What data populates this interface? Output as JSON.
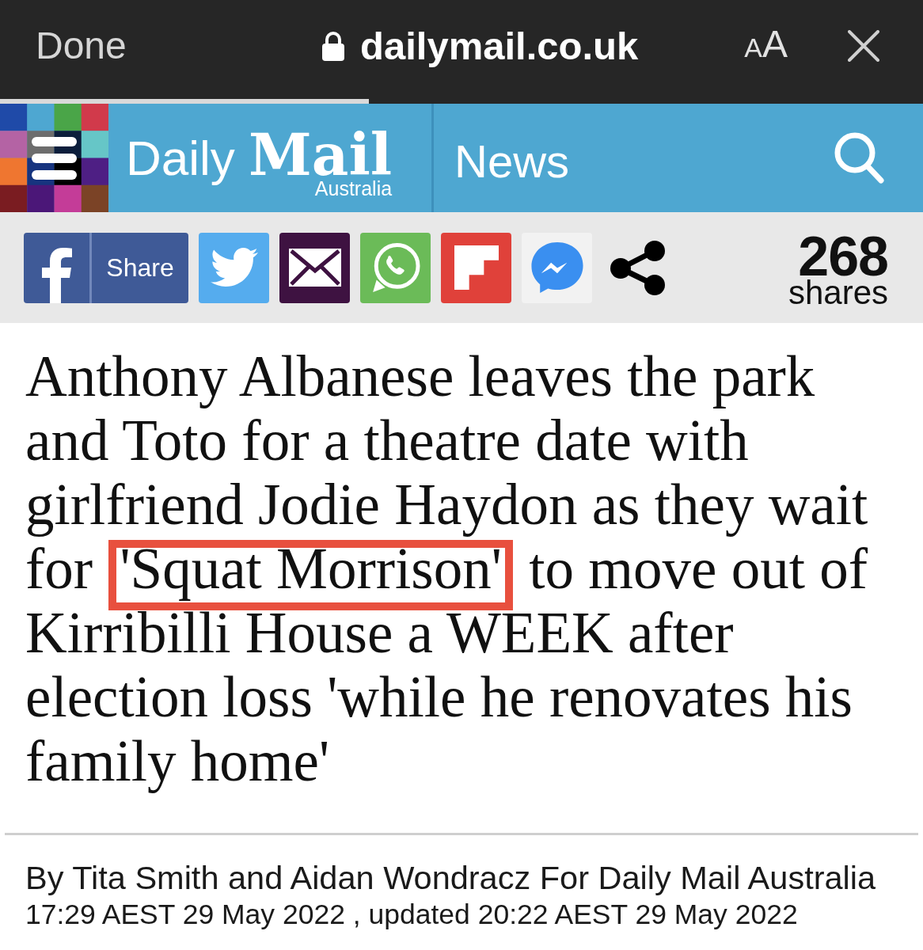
{
  "browser_bar": {
    "done_button": "Done",
    "address": "dailymail.co.uk",
    "text_size_button": {
      "small_letter": "A",
      "large_letter": "A"
    }
  },
  "load_progress": {
    "level": 0.4
  },
  "site_header": {
    "logo": {
      "name": "Daily **Mail**",
      "edition": "Australia"
    },
    "section": "News"
  },
  "share_bar": {
    "buttons": [
      {
        "kind": "facebook",
        "label": "Share"
      },
      {
        "kind": "twitter"
      },
      {
        "kind": "email"
      },
      {
        "kind": "whatsapp"
      },
      {
        "kind": "flipboard"
      },
      {
        "kind": "messenger"
      },
      {
        "kind": "share"
      }
    ],
    "count": "268",
    "count_label": "shares"
  },
  "article": {
    "headline": [
      {
        "text": "Anthony Albanese leaves the park and Toto for a theatre date with girlfriend Jodie Haydon as they wait for ",
        "highlighted": false
      },
      {
        "text": "'Squat Morrison'",
        "highlighted": true
      },
      {
        "text": " to move out of Kirribilli House a WEEK after election loss 'while he renovates his family home'",
        "highlighted": false
      }
    ],
    "byline": "By Tita Smith and Aidan Wondracz For Daily Mail Australia",
    "dateline": "17:29 AEST 29 May 2022 , updated 20:22 AEST 29 May 2022"
  }
}
